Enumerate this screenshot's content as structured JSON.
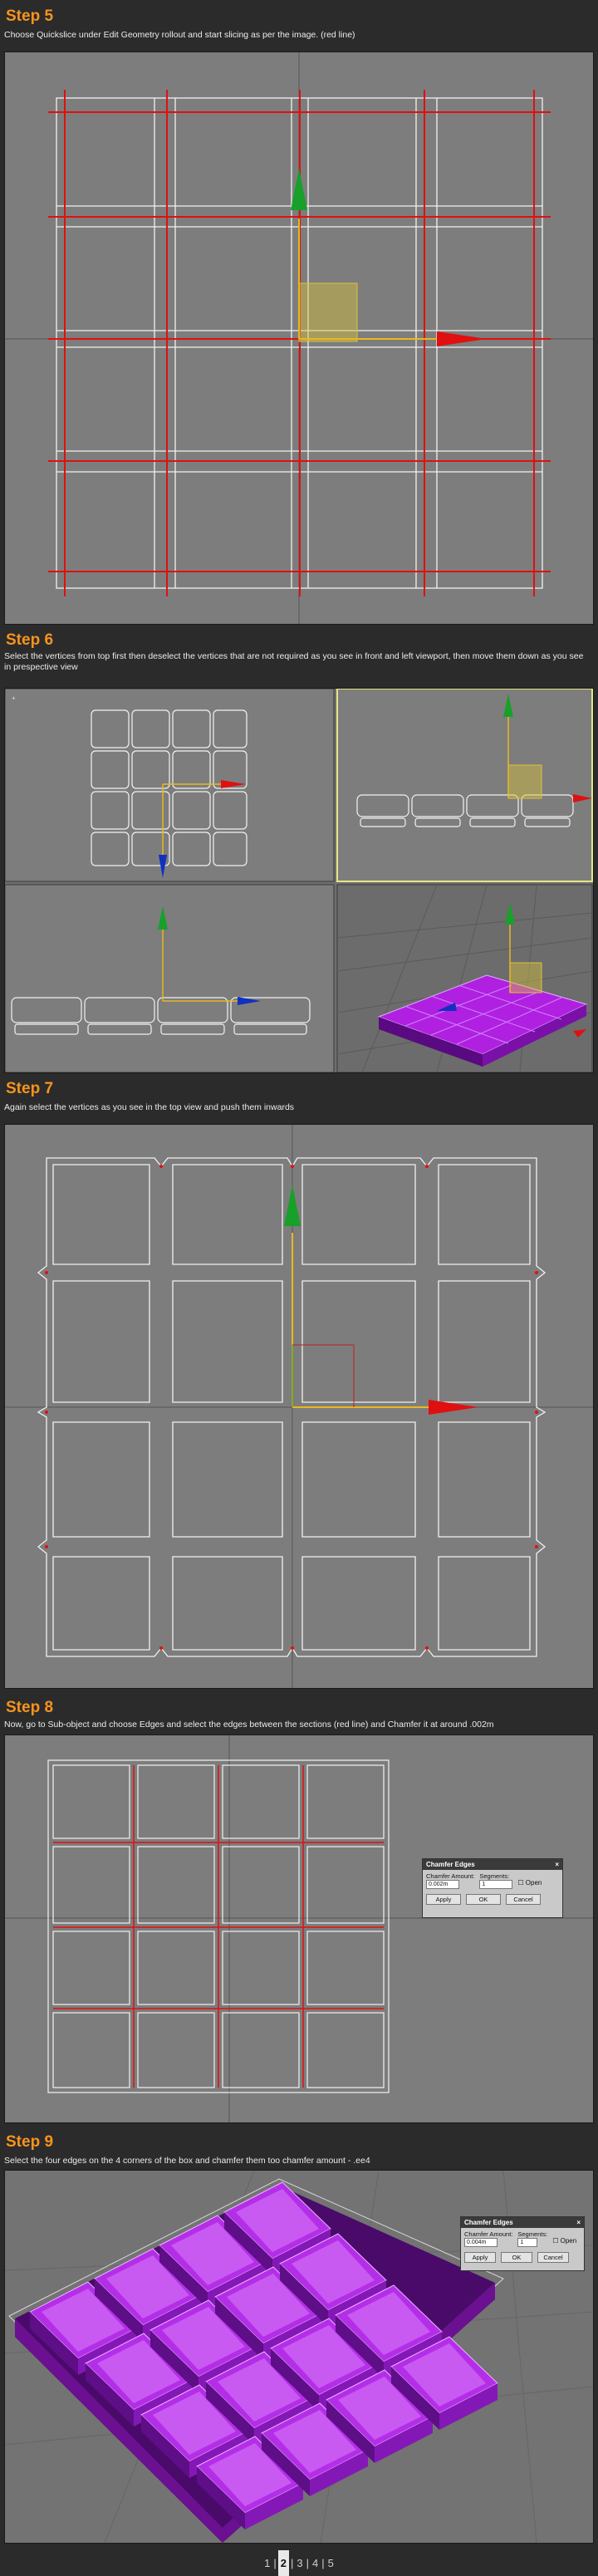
{
  "steps": [
    {
      "title": "Step 5",
      "description": "Choose Quickslice under Edit Geometry rollout and start slicing as per the image. (red line)"
    },
    {
      "title": "Step 6",
      "description": "Select the vertices from top first then deselect the vertices that are not required as you see in front and left viewport, then move them down as you see in prespective view"
    },
    {
      "title": "Step 7",
      "description": "Again select the vertices as you see in the top view and push them inwards"
    },
    {
      "title": "Step 8",
      "description": "Now, go to Sub-object and choose Edges and select the edges between the sections (red line) and Chamfer it at around .002m"
    },
    {
      "title": "Step 9",
      "description": "Select the four edges on the 4 corners of the box and chamfer them too chamfer amount - .ee4"
    }
  ],
  "dialogs": [
    {
      "title": "Chamfer Edges",
      "close": "×",
      "amount_label": "Chamfer Amount:",
      "amount_value": "0.002m",
      "segments_label": "Segments:",
      "segments_value": "1",
      "open_label": "Open",
      "apply": "Apply",
      "ok": "OK",
      "cancel": "Cancel"
    },
    {
      "title": "Chamfer Edges",
      "close": "×",
      "amount_label": "Chamfer Amount:",
      "amount_value": "0.004m",
      "segments_label": "Segments:",
      "segments_value": "1",
      "open_label": "Open",
      "apply": "Apply",
      "ok": "OK",
      "cancel": "Cancel"
    }
  ],
  "pagination": {
    "pages": [
      "1",
      "2",
      "3",
      "4",
      "5"
    ],
    "current": "2",
    "separator": "|"
  },
  "colors": {
    "accent": "#f7941d",
    "slice": "#e01010",
    "mesh": "#f2f2f2",
    "viewport": "#7d7d7d",
    "selected_viewport_border": "#e6e68a",
    "purple": "#a020d0"
  }
}
